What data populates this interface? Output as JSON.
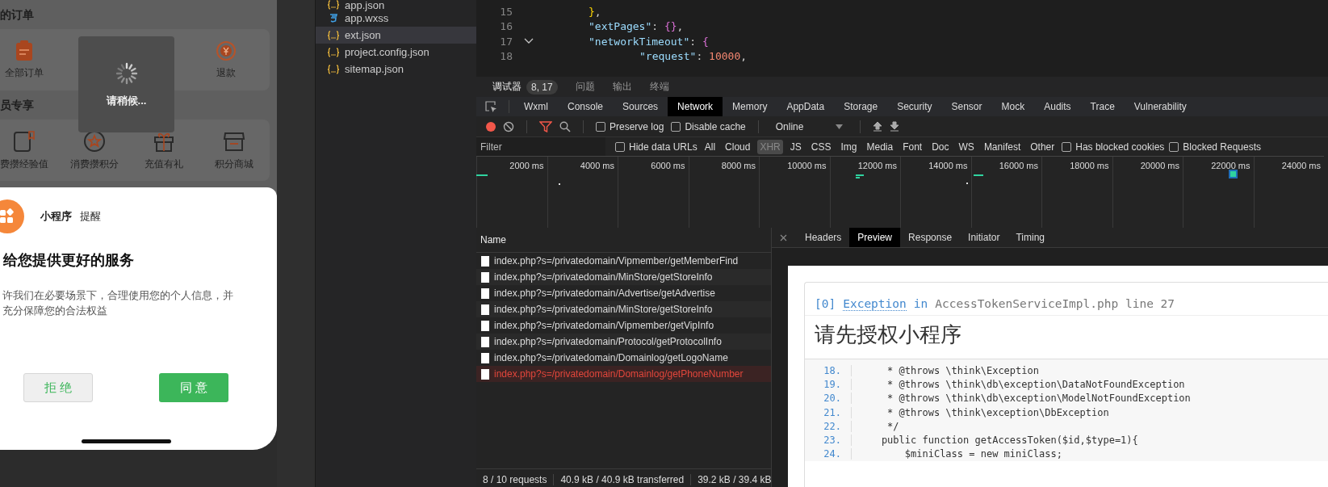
{
  "phone": {
    "order_section": "的订单",
    "order_items": [
      {
        "label": "全部订单",
        "kind": "clipboard"
      },
      {
        "label": "退款",
        "kind": "yen"
      }
    ],
    "member_section": "员专享",
    "member_items": [
      {
        "label": "费攒经验值",
        "kind": "note"
      },
      {
        "label": "消费攒积分",
        "kind": "star"
      },
      {
        "label": "充值有礼",
        "kind": "gift"
      },
      {
        "label": "积分商城",
        "kind": "shop"
      }
    ],
    "loading_toast": {
      "text": "请稍候..."
    },
    "dialog": {
      "app_name": "小程序",
      "tag": "提醒",
      "heading": "给您提供更好的服务",
      "body_lines": [
        "许我们在必要场景下，合理使用您的个人信息，并",
        "充分保障您的合法权益"
      ],
      "buttons": [
        {
          "label": "拒 绝",
          "kind": "reject"
        },
        {
          "label": "同 意",
          "kind": "accept"
        }
      ]
    }
  },
  "file_tree": [
    {
      "name": "app.json",
      "kind": "json",
      "selected": false
    },
    {
      "name": "app.wxss",
      "kind": "wxss",
      "selected": false
    },
    {
      "name": "ext.json",
      "kind": "json",
      "selected": true
    },
    {
      "name": "project.config.json",
      "kind": "json",
      "selected": false
    },
    {
      "name": "sitemap.json",
      "kind": "json",
      "selected": false
    }
  ],
  "editor": {
    "lines": [
      {
        "number": "15",
        "fold": false,
        "parts": [
          {
            "kind": "brace-gold",
            "text": "}"
          },
          {
            "kind": "punct",
            "text": ","
          }
        ]
      },
      {
        "number": "16",
        "fold": false,
        "parts": [
          {
            "kind": "key",
            "text": "\"extPages\""
          },
          {
            "kind": "punct",
            "text": ": "
          },
          {
            "kind": "brace-purple",
            "text": "{}"
          },
          {
            "kind": "punct",
            "text": ","
          }
        ]
      },
      {
        "number": "17",
        "fold": true,
        "parts": [
          {
            "kind": "key",
            "text": "\"networkTimeout\""
          },
          {
            "kind": "punct",
            "text": ": "
          },
          {
            "kind": "brace-purple",
            "text": "{"
          }
        ],
        "children": [
          {
            "number": "18",
            "fold": false,
            "parts": [
              {
                "kind": "key",
                "text": "\"request\""
              },
              {
                "kind": "punct",
                "text": ": "
              },
              {
                "kind": "number",
                "text": "10000"
              },
              {
                "kind": "punct",
                "text": ","
              }
            ]
          }
        ]
      }
    ]
  },
  "panel_tabs": [
    {
      "label": "调试器",
      "badge": "8, 17",
      "selected": true
    },
    {
      "label": "问题",
      "selected": false
    },
    {
      "label": "输出",
      "selected": false
    },
    {
      "label": "终端",
      "selected": false
    }
  ],
  "devtools_tabs": [
    {
      "label": "Wxml",
      "selected": false
    },
    {
      "label": "Console",
      "selected": false
    },
    {
      "label": "Sources",
      "selected": false
    },
    {
      "label": "Network",
      "selected": true
    },
    {
      "label": "Memory",
      "selected": false
    },
    {
      "label": "AppData",
      "selected": false
    },
    {
      "label": "Storage",
      "selected": false
    },
    {
      "label": "Security",
      "selected": false
    },
    {
      "label": "Sensor",
      "selected": false
    },
    {
      "label": "Mock",
      "selected": false
    },
    {
      "label": "Audits",
      "selected": false
    },
    {
      "label": "Trace",
      "selected": false
    },
    {
      "label": "Vulnerability",
      "selected": false
    }
  ],
  "toolbar": {
    "recording": true,
    "preserve_log": {
      "label": "Preserve log",
      "checked": false
    },
    "disable_cache": {
      "label": "Disable cache",
      "checked": false
    },
    "throttling": "Online"
  },
  "filter_bar": {
    "placeholder": "Filter",
    "hide_data_urls": {
      "label": "Hide data URLs",
      "checked": false
    },
    "types": [
      {
        "label": "All",
        "selected": false
      },
      {
        "label": "Cloud",
        "selected": false
      },
      {
        "label": "XHR",
        "selected": true
      },
      {
        "label": "JS",
        "selected": false
      },
      {
        "label": "CSS",
        "selected": false
      },
      {
        "label": "Img",
        "selected": false
      },
      {
        "label": "Media",
        "selected": false
      },
      {
        "label": "Font",
        "selected": false
      },
      {
        "label": "Doc",
        "selected": false
      },
      {
        "label": "WS",
        "selected": false
      },
      {
        "label": "Manifest",
        "selected": false
      },
      {
        "label": "Other",
        "selected": false
      }
    ],
    "has_blocked_cookies": {
      "label": "Has blocked cookies",
      "checked": false
    },
    "blocked_requests": {
      "label": "Blocked Requests",
      "checked": false
    }
  },
  "timeline": {
    "ticks": [
      "2000 ms",
      "4000 ms",
      "6000 ms",
      "8000 ms",
      "10000 ms",
      "12000 ms",
      "14000 ms",
      "16000 ms",
      "18000 ms",
      "20000 ms",
      "22000 ms",
      "24000 ms"
    ]
  },
  "requests": {
    "column": "Name",
    "rows": [
      {
        "name": "index.php?s=/privatedomain/Vipmember/getMemberFind",
        "error": false
      },
      {
        "name": "index.php?s=/privatedomain/MinStore/getStoreInfo",
        "error": false
      },
      {
        "name": "index.php?s=/privatedomain/Advertise/getAdvertise",
        "error": false
      },
      {
        "name": "index.php?s=/privatedomain/MinStore/getStoreInfo",
        "error": false
      },
      {
        "name": "index.php?s=/privatedomain/Vipmember/getVipInfo",
        "error": false
      },
      {
        "name": "index.php?s=/privatedomain/Protocol/getProtocolInfo",
        "error": false
      },
      {
        "name": "index.php?s=/privatedomain/Domainlog/getLogoName",
        "error": false
      },
      {
        "name": "index.php?s=/privatedomain/Domainlog/getPhoneNumber",
        "error": true
      }
    ],
    "status": [
      "8 / 10 requests",
      "40.9 kB / 40.9 kB transferred",
      "39.2 kB / 39.4 kB"
    ]
  },
  "detail_tabs": [
    {
      "label": "Headers",
      "selected": false
    },
    {
      "label": "Preview",
      "selected": true
    },
    {
      "label": "Response",
      "selected": false
    },
    {
      "label": "Initiator",
      "selected": false
    },
    {
      "label": "Timing",
      "selected": false
    }
  ],
  "preview": {
    "index": "[0]",
    "exception": "Exception",
    "in": "in",
    "location": "AccessTokenServiceImpl.php line 27",
    "message": "请先授权小程序",
    "source": [
      {
        "number": "18.",
        "text": "     * @throws \\think\\Exception"
      },
      {
        "number": "19.",
        "text": "     * @throws \\think\\db\\exception\\DataNotFoundException"
      },
      {
        "number": "20.",
        "text": "     * @throws \\think\\db\\exception\\ModelNotFoundException"
      },
      {
        "number": "21.",
        "text": "     * @throws \\think\\exception\\DbException"
      },
      {
        "number": "22.",
        "text": "     */"
      },
      {
        "number": "23.",
        "text": "    public function getAccessToken($id,$type=1){"
      },
      {
        "number": "24.",
        "text": "        $miniClass = new miniClass;"
      }
    ]
  }
}
